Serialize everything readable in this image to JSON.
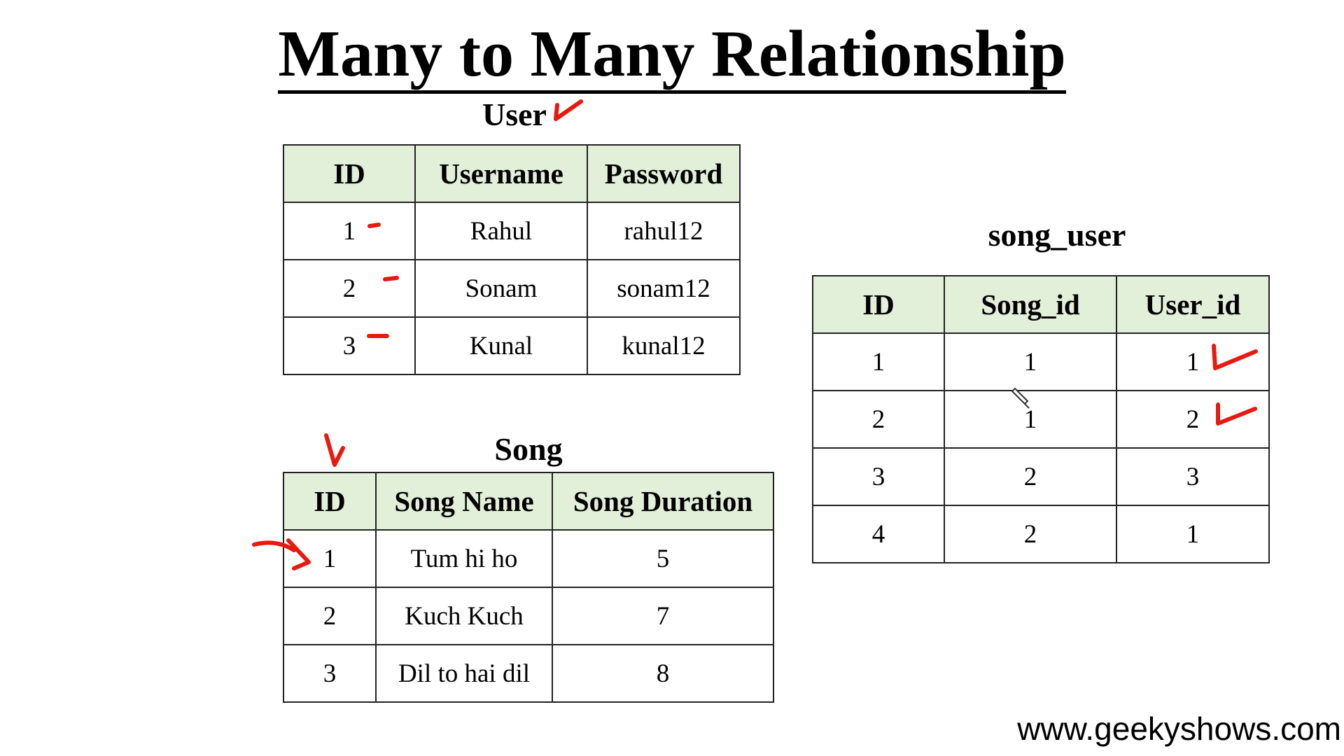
{
  "title": "Many to Many Relationship",
  "user_table": {
    "caption": "User",
    "headers": [
      "ID",
      "Username",
      "Password"
    ],
    "rows": [
      [
        "1",
        "Rahul",
        "rahul12"
      ],
      [
        "2",
        "Sonam",
        "sonam12"
      ],
      [
        "3",
        "Kunal",
        "kunal12"
      ]
    ]
  },
  "song_table": {
    "caption": "Song",
    "headers": [
      "ID",
      "Song Name",
      "Song Duration"
    ],
    "rows": [
      [
        "1",
        "Tum hi ho",
        "5"
      ],
      [
        "2",
        "Kuch Kuch",
        "7"
      ],
      [
        "3",
        "Dil to hai dil",
        "8"
      ]
    ]
  },
  "song_user_table": {
    "caption": "song_user",
    "headers": [
      "ID",
      "Song_id",
      "User_id"
    ],
    "rows": [
      [
        "1",
        "1",
        "1"
      ],
      [
        "2",
        "1",
        "2"
      ],
      [
        "3",
        "2",
        "3"
      ],
      [
        "4",
        "2",
        "1"
      ]
    ]
  },
  "footer": "www.geekyshows.com",
  "colors": {
    "header_fill": "#e2efd9",
    "annotation_ink": "#e8190f"
  },
  "icons": [
    "pen-cursor-icon"
  ]
}
